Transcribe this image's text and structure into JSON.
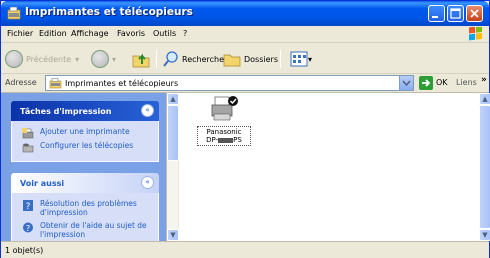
{
  "window": {
    "title": "Imprimantes et télécopieurs",
    "icons": [
      "printers-folder-icon",
      "minimize-icon",
      "maximize-icon",
      "close-icon"
    ]
  },
  "menu": {
    "items": [
      "Fichier",
      "Edition",
      "Affichage",
      "Favoris",
      "Outils",
      "?"
    ]
  },
  "toolbar": {
    "back_label": "Précédente",
    "search_label": "Rechercher",
    "folders_label": "Dossiers"
  },
  "address": {
    "label": "Adresse",
    "value": "Imprimantes et télécopieurs",
    "go_label": "OK",
    "links_label": "Liens",
    "links_more": "»"
  },
  "sidebar": {
    "tasks": {
      "title": "Tâches d'impression",
      "collapse_glyph": "«",
      "items": [
        {
          "label": "Ajouter une imprimante",
          "icon": "add-printer-icon"
        },
        {
          "label": "Configurer les télécopies",
          "icon": "fax-icon"
        }
      ]
    },
    "see_also": {
      "title": "Voir aussi",
      "collapse_glyph": "«",
      "items": [
        {
          "label": "Résolution des problèmes d'impression",
          "icon": "help-icon"
        },
        {
          "label": "Obtenir de l'aide au sujet de l'impression",
          "icon": "help-circle-icon"
        }
      ]
    }
  },
  "content": {
    "printer": {
      "name_line1": "Panasonic",
      "name_line2": "DP-",
      "name_line3": "PS",
      "status_badge": "default-printer-check"
    }
  },
  "scroll": {
    "up": "▲",
    "down": "▼"
  },
  "status": {
    "text": "1 objet(s)"
  },
  "colors": {
    "titlebar": "#0058ee",
    "sidebar_bg": "#7aa1e6",
    "panel_special": "#0c32a8",
    "link": "#215dc6"
  }
}
